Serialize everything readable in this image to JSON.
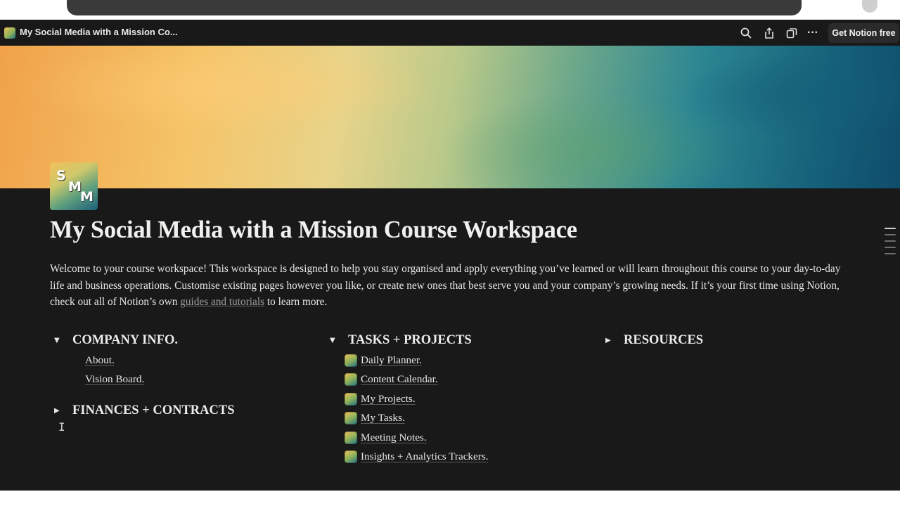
{
  "window": {
    "title": "My Social Media with a Mission Co...",
    "get_notion_label": "Get Notion free",
    "icons": [
      "search-icon",
      "share-icon",
      "duplicate-icon",
      "more-icon"
    ]
  },
  "page": {
    "icon_letters": [
      "S",
      "M",
      "M"
    ],
    "title": "My Social Media with a Mission Course Workspace",
    "intro_before": "Welcome to your course workspace! This workspace is designed to help you stay organised and apply everything you’ve learned or will learn throughout this course to your day-to-day life and business operations. Customise existing pages however you like, or create new ones that best serve you and your company’s growing needs. If it’s your first time using Notion, check out all of Notion’s own ",
    "intro_link": "guides and tutorials",
    "intro_after": " to learn more."
  },
  "sections": {
    "company_info": {
      "heading": "COMPANY INFO.",
      "expanded": true,
      "items": [
        "About.",
        "Vision Board."
      ]
    },
    "finances": {
      "heading": "FINANCES + CONTRACTS",
      "expanded": false
    },
    "tasks": {
      "heading": "TASKS + PROJECTS",
      "expanded": true,
      "items": [
        "Daily Planner.",
        "Content Calendar.",
        "My Projects.",
        "My Tasks.",
        "Meeting Notes.",
        "Insights + Analytics Trackers."
      ]
    },
    "resources": {
      "heading": "RESOURCES",
      "expanded": false
    }
  },
  "glyphs": {
    "expanded": "▼",
    "collapsed": "▶",
    "more": "···"
  }
}
